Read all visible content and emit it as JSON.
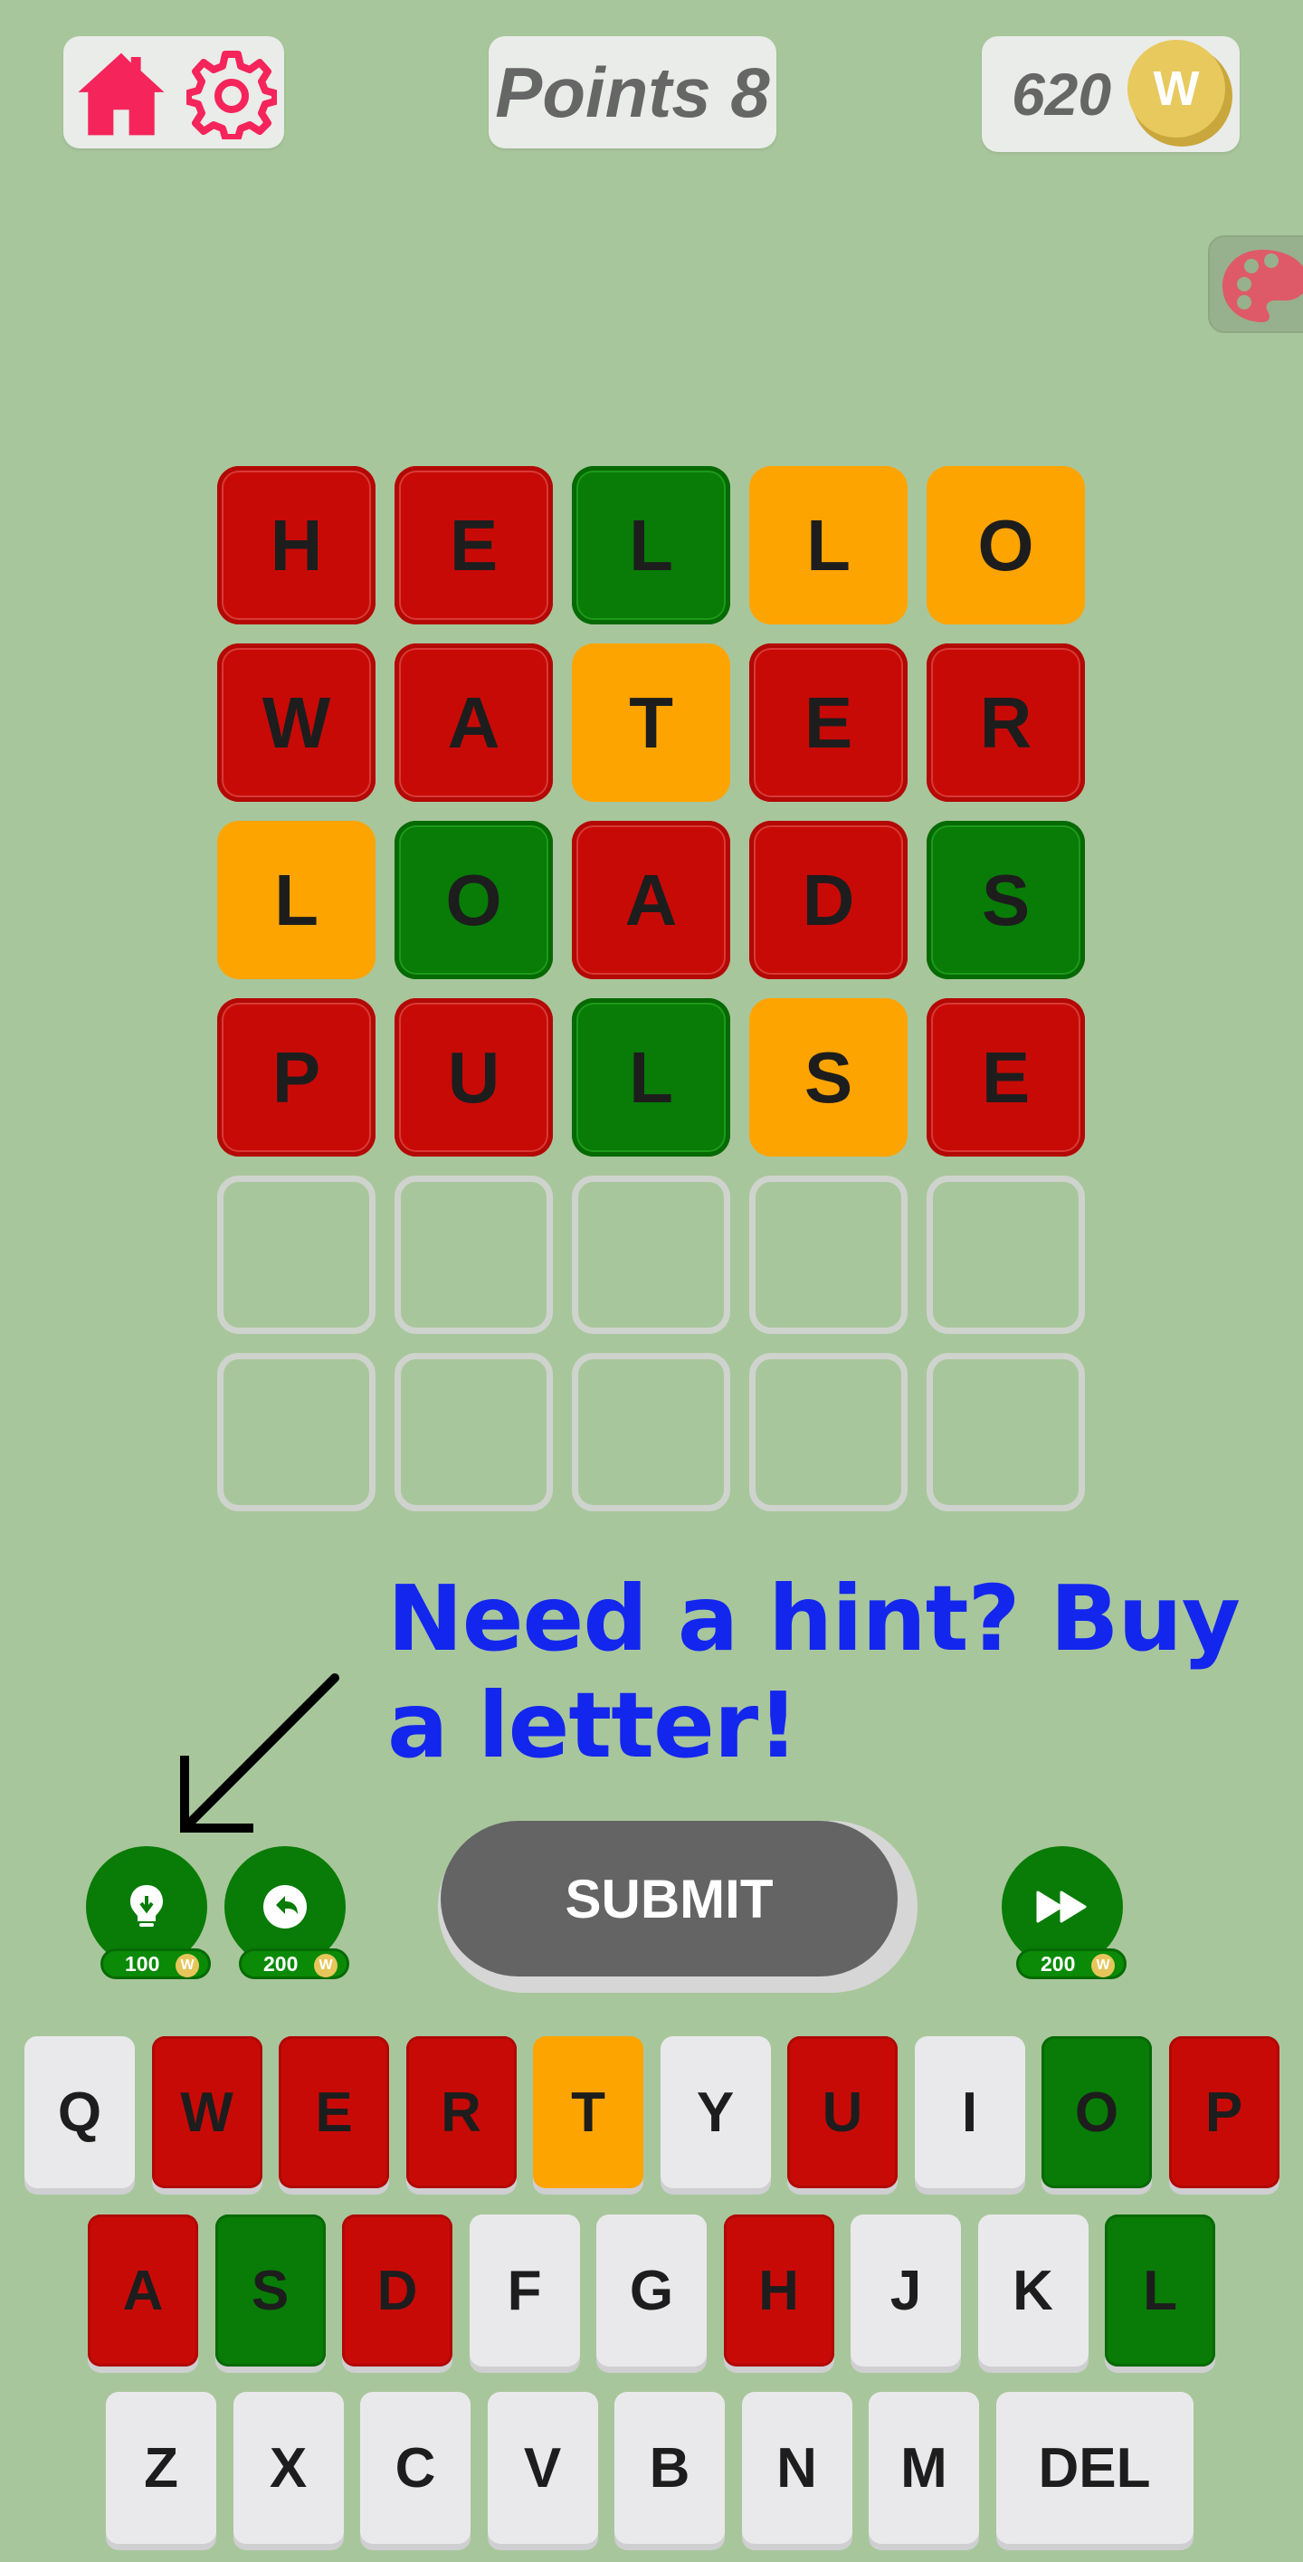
{
  "header": {
    "points_label": "Points 8",
    "coins": "620",
    "coin_symbol": "W"
  },
  "grid": {
    "rows": [
      [
        {
          "letter": "H",
          "state": "red"
        },
        {
          "letter": "E",
          "state": "red"
        },
        {
          "letter": "L",
          "state": "green"
        },
        {
          "letter": "L",
          "state": "orange"
        },
        {
          "letter": "O",
          "state": "orange"
        }
      ],
      [
        {
          "letter": "W",
          "state": "red"
        },
        {
          "letter": "A",
          "state": "red"
        },
        {
          "letter": "T",
          "state": "orange"
        },
        {
          "letter": "E",
          "state": "red"
        },
        {
          "letter": "R",
          "state": "red"
        }
      ],
      [
        {
          "letter": "L",
          "state": "orange"
        },
        {
          "letter": "O",
          "state": "green"
        },
        {
          "letter": "A",
          "state": "red"
        },
        {
          "letter": "D",
          "state": "red"
        },
        {
          "letter": "S",
          "state": "green"
        }
      ],
      [
        {
          "letter": "P",
          "state": "red"
        },
        {
          "letter": "U",
          "state": "red"
        },
        {
          "letter": "L",
          "state": "green"
        },
        {
          "letter": "S",
          "state": "orange"
        },
        {
          "letter": "E",
          "state": "red"
        }
      ],
      [
        {
          "letter": "",
          "state": "empty"
        },
        {
          "letter": "",
          "state": "empty"
        },
        {
          "letter": "",
          "state": "empty"
        },
        {
          "letter": "",
          "state": "empty"
        },
        {
          "letter": "",
          "state": "empty"
        }
      ],
      [
        {
          "letter": "",
          "state": "empty"
        },
        {
          "letter": "",
          "state": "empty"
        },
        {
          "letter": "",
          "state": "empty"
        },
        {
          "letter": "",
          "state": "empty"
        },
        {
          "letter": "",
          "state": "empty"
        }
      ]
    ]
  },
  "hint_text": "Need a hint? Buy a letter!",
  "actions": {
    "hint_price": "100",
    "undo_price": "200",
    "skip_price": "200",
    "coin_symbol": "W",
    "submit_label": "SUBMIT"
  },
  "keyboard": {
    "rows": [
      [
        {
          "key": "Q",
          "state": "default"
        },
        {
          "key": "W",
          "state": "red"
        },
        {
          "key": "E",
          "state": "red"
        },
        {
          "key": "R",
          "state": "red"
        },
        {
          "key": "T",
          "state": "orange"
        },
        {
          "key": "Y",
          "state": "default"
        },
        {
          "key": "U",
          "state": "red"
        },
        {
          "key": "I",
          "state": "default"
        },
        {
          "key": "O",
          "state": "green"
        },
        {
          "key": "P",
          "state": "red"
        }
      ],
      [
        {
          "key": "A",
          "state": "red"
        },
        {
          "key": "S",
          "state": "green"
        },
        {
          "key": "D",
          "state": "red"
        },
        {
          "key": "F",
          "state": "default"
        },
        {
          "key": "G",
          "state": "default"
        },
        {
          "key": "H",
          "state": "red"
        },
        {
          "key": "J",
          "state": "default"
        },
        {
          "key": "K",
          "state": "default"
        },
        {
          "key": "L",
          "state": "green"
        }
      ],
      [
        {
          "key": "Z",
          "state": "default"
        },
        {
          "key": "X",
          "state": "default"
        },
        {
          "key": "C",
          "state": "default"
        },
        {
          "key": "V",
          "state": "default"
        },
        {
          "key": "B",
          "state": "default"
        },
        {
          "key": "N",
          "state": "default"
        },
        {
          "key": "M",
          "state": "default"
        },
        {
          "key": "DEL",
          "state": "default"
        }
      ]
    ]
  },
  "colors": {
    "background": "#a8c69c",
    "correct": "#087c06",
    "present": "#fea400",
    "absent": "#c80a06",
    "icon_pink": "#f5245a",
    "hint_blue": "#1326ee"
  }
}
